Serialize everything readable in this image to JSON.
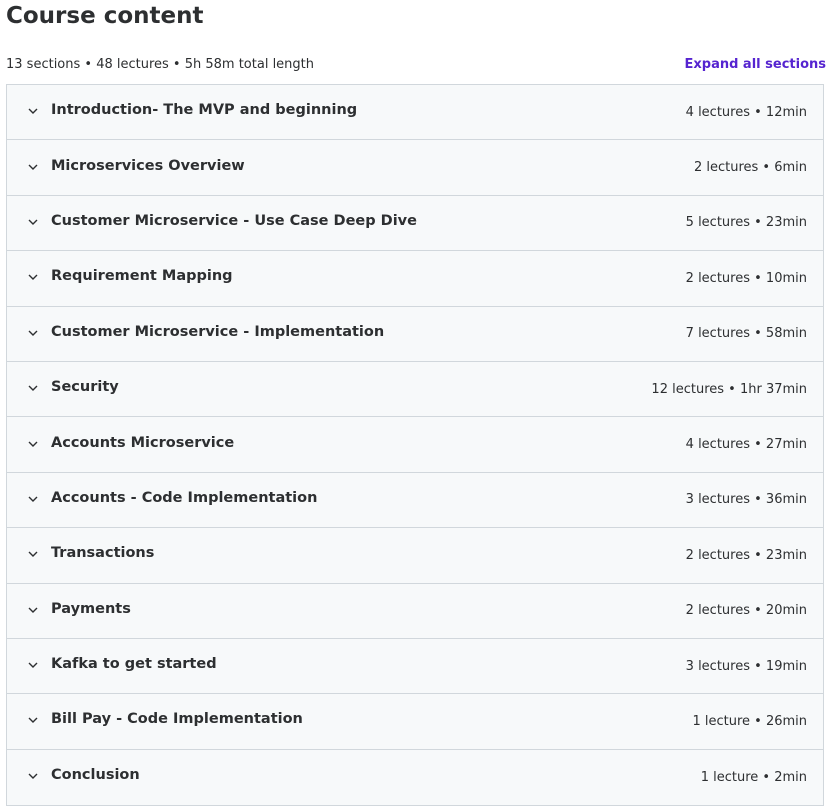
{
  "header": {
    "title": "Course content",
    "summary": "13 sections • 48 lectures • 5h 58m total length",
    "expand_all_label": "Expand all sections"
  },
  "icons": {
    "section_toggle": "chevron-down-icon"
  },
  "colors": {
    "accent": "#5624d0",
    "section_bg": "#f7f9fa",
    "border": "#d1d7dc",
    "text": "#2d2f31"
  },
  "sections": [
    {
      "title": "Introduction- The MVP and beginning",
      "meta": "4 lectures • 12min"
    },
    {
      "title": "Microservices Overview",
      "meta": "2 lectures • 6min"
    },
    {
      "title": "Customer Microservice - Use Case Deep Dive",
      "meta": "5 lectures • 23min"
    },
    {
      "title": "Requirement Mapping",
      "meta": "2 lectures • 10min"
    },
    {
      "title": "Customer Microservice - Implementation",
      "meta": "7 lectures • 58min"
    },
    {
      "title": "Security",
      "meta": "12 lectures • 1hr 37min"
    },
    {
      "title": "Accounts Microservice",
      "meta": "4 lectures • 27min"
    },
    {
      "title": "Accounts - Code Implementation",
      "meta": "3 lectures • 36min"
    },
    {
      "title": "Transactions",
      "meta": "2 lectures • 23min"
    },
    {
      "title": "Payments",
      "meta": "2 lectures • 20min"
    },
    {
      "title": "Kafka to get started",
      "meta": "3 lectures • 19min"
    },
    {
      "title": "Bill Pay - Code Implementation",
      "meta": "1 lecture • 26min"
    },
    {
      "title": "Conclusion",
      "meta": "1 lecture • 2min"
    }
  ]
}
